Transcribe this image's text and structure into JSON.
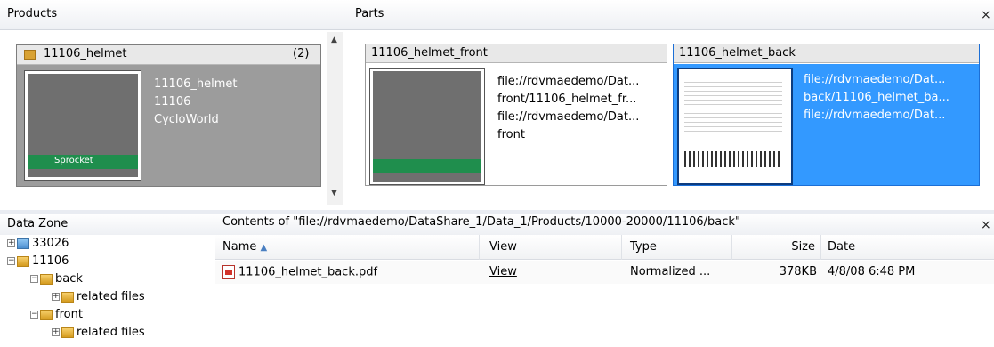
{
  "products_pane": {
    "title": "Products",
    "card": {
      "name": "11106_helmet",
      "count": "(2)",
      "lines": [
        "11106_helmet",
        "11106",
        "CycloWorld"
      ],
      "thumb_brand": "Sprocket"
    }
  },
  "parts_pane": {
    "title": "Parts",
    "close": "×",
    "cards": [
      {
        "name": "11106_helmet_front",
        "lines": [
          "file://rdvmaedemo/Dat...",
          "front/11106_helmet_fr...",
          "file://rdvmaedemo/Dat...",
          "front"
        ]
      },
      {
        "name": "11106_helmet_back",
        "lines": [
          "file://rdvmaedemo/Dat...",
          "back/11106_helmet_ba...",
          "file://rdvmaedemo/Dat..."
        ]
      }
    ]
  },
  "data_zone": {
    "title": "Data Zone",
    "tree": [
      {
        "label": "33026",
        "expander": "+"
      },
      {
        "label": "11106",
        "expander": "−"
      },
      {
        "label": "back",
        "expander": "−"
      },
      {
        "label": "related files",
        "expander": "+"
      },
      {
        "label": "front",
        "expander": "−"
      },
      {
        "label": "related files",
        "expander": "+"
      }
    ]
  },
  "contents": {
    "title": "Contents of \"file://rdvmaedemo/DataShare_1/Data_1/Products/10000-20000/11106/back\"",
    "close": "×",
    "columns": {
      "name": "Name",
      "view": "View",
      "type": "Type",
      "size": "Size",
      "date": "Date"
    },
    "rows": [
      {
        "name": "11106_helmet_back.pdf",
        "view": "View",
        "type": "Normalized ...",
        "size": "378KB",
        "date": "4/8/08 6:48 PM"
      }
    ]
  },
  "colors": {
    "selection": "#3399ff",
    "product_card": "#9c9c9c"
  }
}
